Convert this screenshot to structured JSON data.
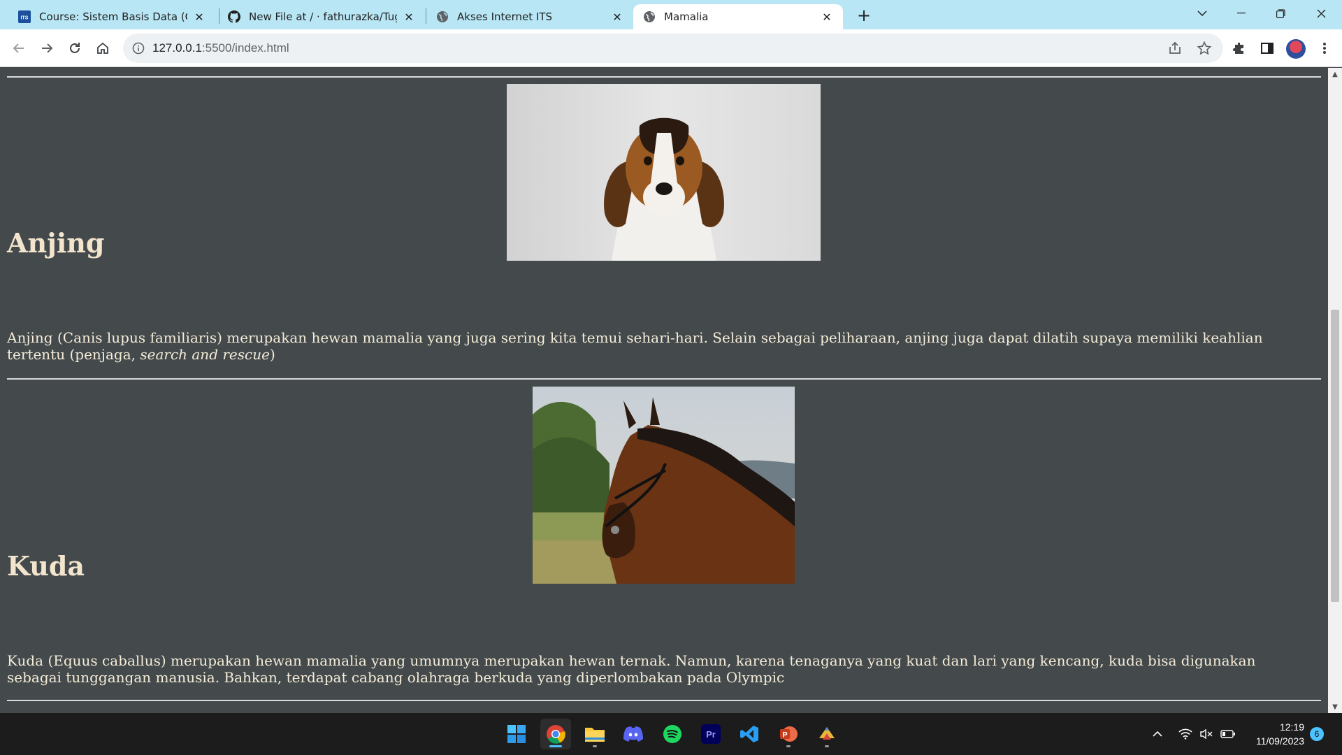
{
  "browser": {
    "tabs": [
      {
        "title": "Course: Sistem Basis Data (C)",
        "icon": "its-logo-icon",
        "active": false
      },
      {
        "title": "New File at / · fathurazka/Tugas-",
        "icon": "github-icon",
        "active": false
      },
      {
        "title": "Akses Internet ITS",
        "icon": "globe-icon",
        "active": false
      },
      {
        "title": "Mamalia",
        "icon": "globe-icon",
        "active": true
      }
    ],
    "new_tab_glyph": "+",
    "url": {
      "host": "127.0.0.1",
      "path": ":5500/index.html"
    }
  },
  "page": {
    "sections": [
      {
        "heading": "Anjing",
        "image_subject": "beagle puppy",
        "text_main": "Anjing (Canis lupus familiaris) merupakan hewan mamalia yang juga sering kita temui sehari-hari. Selain sebagai peliharaan, anjing juga dapat dilatih supaya memiliki keahlian tertentu (penjaga, ",
        "text_italic": "search and rescue",
        "text_end": ")"
      },
      {
        "heading": "Kuda",
        "image_subject": "brown horse",
        "text_main": "Kuda (Equus caballus) merupakan hewan mamalia yang umumnya merupakan hewan ternak. Namun, karena tenaganya yang kuat dan lari yang kencang, kuda bisa digunakan sebagai tunggangan manusia. Bahkan, terdapat cabang olahraga berkuda yang diperlombakan pada Olympic"
      }
    ]
  },
  "taskbar": {
    "apps": [
      "windows-start-icon",
      "chrome-icon",
      "file-explorer-icon",
      "discord-icon",
      "spotify-icon",
      "premiere-pro-icon",
      "vscode-icon",
      "powerpoint-icon",
      "app-icon"
    ],
    "premiere_label": "Pr",
    "powerpoint_label": "P",
    "time": "12:19",
    "date": "11/09/2023",
    "notification_count": "6"
  },
  "colors": {
    "page_bg": "#444a4c",
    "heading": "#f3e4ce",
    "body_text": "#f5ecd9",
    "tabstrip": "#b8e6f5"
  }
}
